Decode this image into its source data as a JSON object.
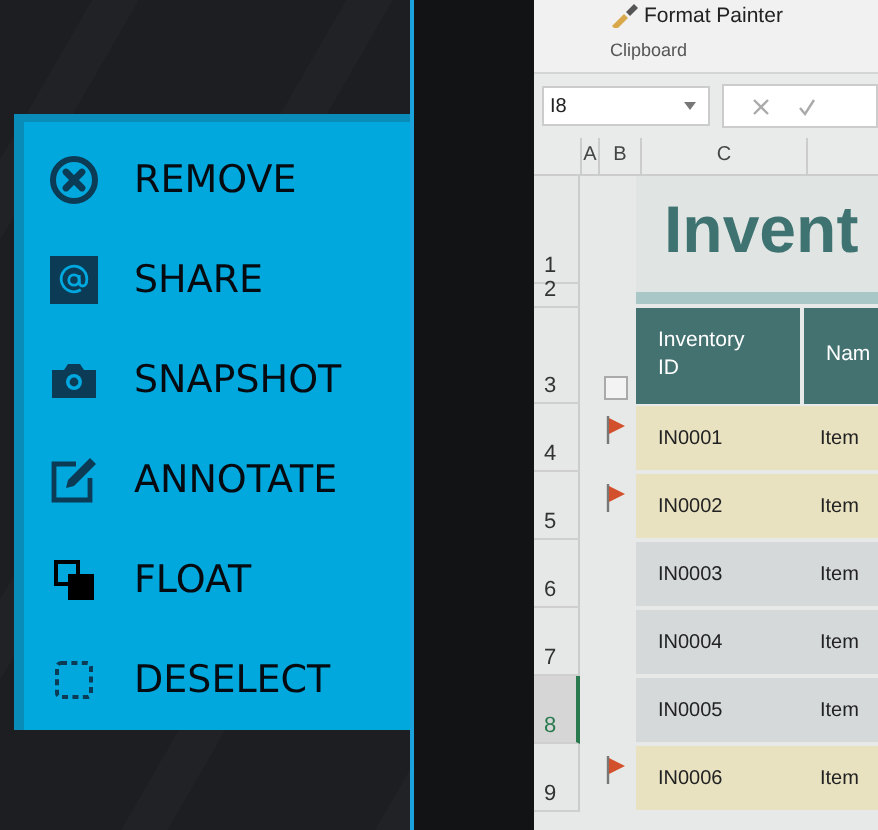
{
  "menu": {
    "items": [
      {
        "label": "REMOVE"
      },
      {
        "label": "SHARE"
      },
      {
        "label": "SNAPSHOT"
      },
      {
        "label": "ANNOTATE"
      },
      {
        "label": "FLOAT"
      },
      {
        "label": "DESELECT"
      }
    ]
  },
  "spreadsheet": {
    "ribbon": {
      "button": "Format Painter",
      "group": "Clipboard"
    },
    "name_box": "I8",
    "columns": [
      "A",
      "B",
      "C"
    ],
    "title": "Invent",
    "header": {
      "cells": [
        "Inventory ID",
        "Nam"
      ]
    },
    "rows": [
      {
        "number": "1"
      },
      {
        "number": "2"
      },
      {
        "number": "3"
      }
    ],
    "data_rows": [
      {
        "number": "4",
        "flagged": true,
        "selected": false,
        "cells": [
          "IN0001",
          "Item"
        ]
      },
      {
        "number": "5",
        "flagged": true,
        "selected": false,
        "cells": [
          "IN0002",
          "Item"
        ]
      },
      {
        "number": "6",
        "flagged": false,
        "selected": false,
        "cells": [
          "IN0003",
          "Item"
        ]
      },
      {
        "number": "7",
        "flagged": false,
        "selected": false,
        "cells": [
          "IN0004",
          "Item"
        ]
      },
      {
        "number": "8",
        "flagged": false,
        "selected": true,
        "cells": [
          "IN0005",
          "Item"
        ]
      },
      {
        "number": "9",
        "flagged": true,
        "selected": false,
        "cells": [
          "IN0006",
          "Item"
        ]
      }
    ]
  }
}
